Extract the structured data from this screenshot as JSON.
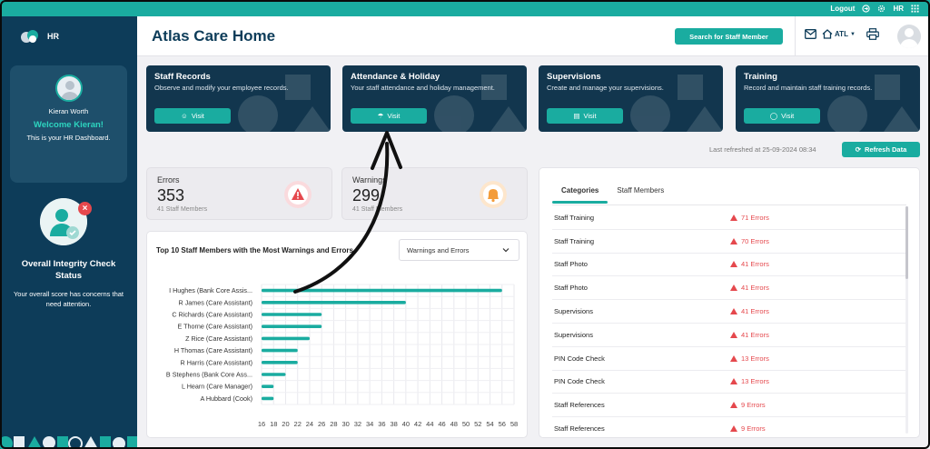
{
  "topbar": {
    "logout_label": "Logout",
    "role_label": "HR"
  },
  "sidebar": {
    "logo_label": "HR",
    "profile": {
      "name": "Kieran Worth",
      "welcome": "Welcome Kieran!",
      "subtitle": "This is your HR Dashboard."
    },
    "integrity": {
      "title": "Overall Integrity Check Status",
      "description": "Your overall score has concerns that need attention.",
      "badge": "×"
    }
  },
  "header": {
    "title": "Atlas Care Home",
    "search_button": "Search for Staff Member",
    "location_label": "ATL"
  },
  "modules": [
    {
      "title": "Staff Records",
      "description": "Observe and modify your employee records.",
      "visit_label": "Visit"
    },
    {
      "title": "Attendance & Holiday",
      "description": "Your staff attendance and holiday management.",
      "visit_label": "Visit"
    },
    {
      "title": "Supervisions",
      "description": "Create and manage your supervisions.",
      "visit_label": "Visit"
    },
    {
      "title": "Training",
      "description": "Record and maintain staff training records.",
      "visit_label": "Visit"
    }
  ],
  "refresh": {
    "text": "Last refreshed at 25-09-2024 08:34",
    "button_label": "Refresh Data"
  },
  "stats": {
    "errors": {
      "label": "Errors",
      "value": "353",
      "sub": "41 Staff Members"
    },
    "warnings": {
      "label": "Warnings",
      "value": "299",
      "sub": "41 Staff Members"
    }
  },
  "chart_panel": {
    "title": "Top 10 Staff Members with the Most Warnings and Errors",
    "select_value": "Warnings and Errors"
  },
  "chart_data": {
    "type": "bar",
    "orientation": "horizontal",
    "categories": [
      "I Hughes (Bank Core Assis...",
      "R James (Care Assistant)",
      "C Richards (Care Assistant)",
      "E Thorne (Care Assistant)",
      "Z Rice (Care Assistant)",
      "H Thomas (Care Assistant)",
      "R Harris (Care Assistant)",
      "B Stephens (Bank Core Ass...",
      "L Hearn (Care Manager)",
      "A Hubbard (Cook)"
    ],
    "values": [
      56,
      40,
      26,
      26,
      24,
      22,
      22,
      20,
      18,
      18
    ],
    "xlim": [
      16,
      58
    ],
    "xticks": [
      16,
      18,
      20,
      22,
      24,
      26,
      28,
      30,
      32,
      34,
      36,
      38,
      40,
      42,
      44,
      46,
      48,
      50,
      52,
      54,
      56,
      58
    ],
    "grid": true,
    "bar_color": "#1aaca0"
  },
  "categories_panel": {
    "tabs": [
      "Categories",
      "Staff Members"
    ],
    "rows": [
      {
        "name": "Staff Training",
        "errors": "71 Errors"
      },
      {
        "name": "Staff Training",
        "errors": "70 Errors"
      },
      {
        "name": "Staff Photo",
        "errors": "41 Errors"
      },
      {
        "name": "Staff Photo",
        "errors": "41 Errors"
      },
      {
        "name": "Supervisions",
        "errors": "41 Errors"
      },
      {
        "name": "Supervisions",
        "errors": "41 Errors"
      },
      {
        "name": "PIN Code Check",
        "errors": "13 Errors"
      },
      {
        "name": "PIN Code Check",
        "errors": "13 Errors"
      },
      {
        "name": "Staff References",
        "errors": "9 Errors"
      },
      {
        "name": "Staff References",
        "errors": "9 Errors"
      }
    ]
  },
  "colors": {
    "accent": "#1aaca0",
    "navy": "#0d3c59",
    "error": "#e5484d",
    "warning": "#f39c3a"
  }
}
